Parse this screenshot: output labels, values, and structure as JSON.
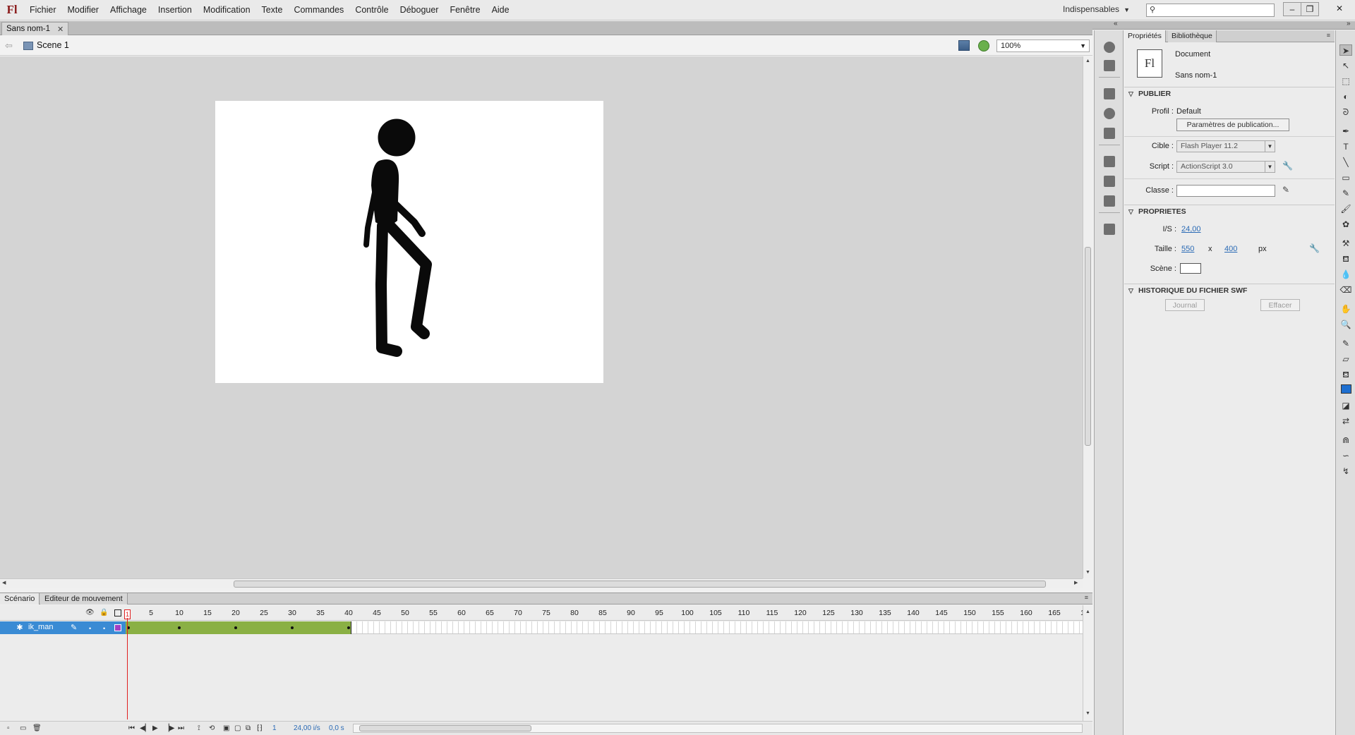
{
  "app": {
    "logo": "Fl",
    "menu": [
      "Fichier",
      "Modifier",
      "Affichage",
      "Insertion",
      "Modification",
      "Texte",
      "Commandes",
      "Contrôle",
      "Déboguer",
      "Fenêtre",
      "Aide"
    ],
    "workspace": "Indispensables",
    "search_placeholder": "",
    "window_buttons": [
      "–",
      "❐",
      "✕"
    ]
  },
  "document": {
    "tab_name": "Sans nom-1",
    "scene_label": "Scene 1",
    "zoom": "100%"
  },
  "stage": {
    "background_color": "#ffffff",
    "figure_color": "#0a0a0a",
    "figure_icon": "stick-figure"
  },
  "timeline": {
    "tabs": [
      "Scénario",
      "Editeur de mouvement"
    ],
    "ruler": [
      "5",
      "10",
      "15",
      "20",
      "25",
      "30",
      "35",
      "40",
      "45",
      "50",
      "55",
      "60",
      "65",
      "70",
      "75",
      "80",
      "85",
      "90",
      "95",
      "100",
      "105",
      "110",
      "115",
      "120",
      "125",
      "130",
      "135",
      "140",
      "145",
      "150",
      "155",
      "160",
      "165",
      "1"
    ],
    "current_frame_marker": "1",
    "layer": {
      "name": "ik_man",
      "tween_frames": 40,
      "keyframes": [
        1,
        10,
        20,
        30,
        40
      ],
      "tween_color": "#8ab044",
      "outline_color": "#a43fc4"
    },
    "status": {
      "frame": "1",
      "fps": "24,00 i/s",
      "time": "0,0 s"
    }
  },
  "properties": {
    "tabs": [
      "Propriétés",
      "Bibliothèque"
    ],
    "doc_icon_text": "Fl",
    "doc_type": "Document",
    "doc_name": "Sans nom-1",
    "publish": {
      "header": "PUBLIER",
      "profil_label": "Profil :",
      "profil_value": "Default",
      "publish_settings_button": "Paramètres de publication...",
      "cible_label": "Cible :",
      "cible_value": "Flash Player 11.2",
      "script_label": "Script :",
      "script_value": "ActionScript 3.0",
      "classe_label": "Classe :",
      "classe_value": ""
    },
    "props": {
      "header": "PROPRIETES",
      "fps_label": "I/S :",
      "fps_value": "24,00",
      "size_label": "Taille :",
      "width": "550",
      "x_sep": "x",
      "height": "400",
      "unit": "px",
      "scene_label": "Scène :"
    },
    "swf_history": {
      "header": "HISTORIQUE DU FICHIER SWF",
      "journal_button": "Journal",
      "clear_button": "Effacer"
    }
  },
  "tools": {
    "accent_fill": "#1e6fd0"
  }
}
